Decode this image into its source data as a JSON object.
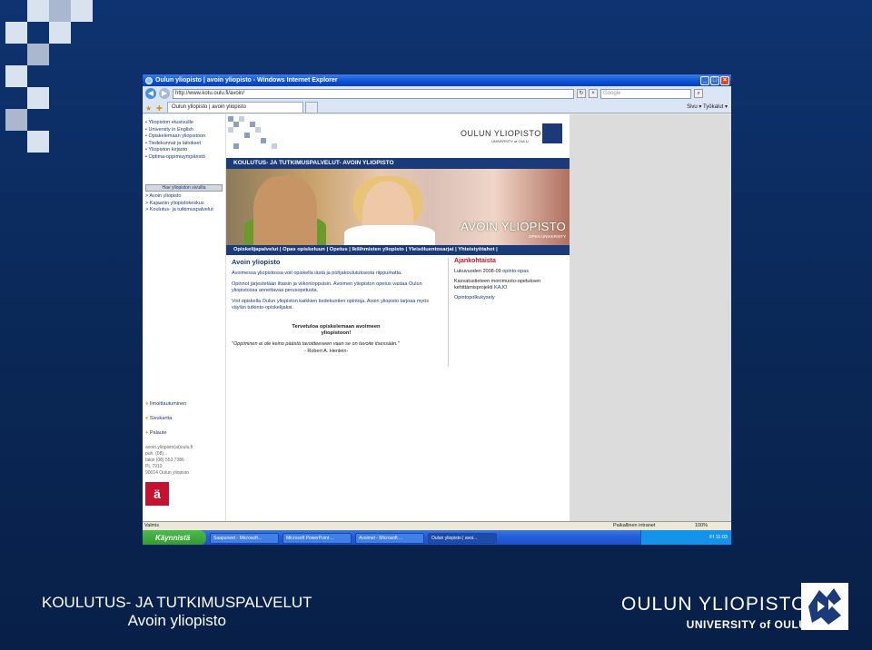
{
  "slide": {
    "title_line1": "KOULUTUS- JA TUTKIMUSPALVELUT",
    "title_line2": "Avoin yliopisto",
    "logo_line1": "OULUN YLIOPISTO",
    "logo_line2": "UNIVERSITY of OULU"
  },
  "window": {
    "title": "Oulun yliopisto | avoin yliopisto - Windows Internet Explorer",
    "url": "http://www.kotu.oulu.fi/avoin/",
    "search_placeholder": "Google",
    "tab_label": "Oulun yliopisto | avoin yliopisto",
    "toolbar_right": "Sivu ▾   Työkalut ▾"
  },
  "sidebar": {
    "items": [
      "Yliopiston etusivuille",
      "University in English",
      "Opiskelemaan yliopistoon",
      "Tiedekunnat ja laitokset",
      "Yliopiston kirjasto",
      "Optima-oppimisympäristö"
    ],
    "search_button": "Hae yliopiston sivuilta",
    "breadcrumbs": [
      "> Avoin yliopisto",
      "> Kajaanin yliopistokeskus",
      "> Koulutus- ja tutkimuspalvelut"
    ],
    "bottom_links": [
      "Ilmoittautuminen",
      "Sivukartta",
      "Palaute"
    ],
    "contact_email": "avoin.yliopisto(at)oulu.fi",
    "contact_phone": "puh. (08)...",
    "contact_fax": "faksi (08) 553 7386",
    "contact_box": "PL 7910",
    "contact_address": "90014 Oulun yliopisto"
  },
  "content": {
    "header_uni": "OULUN YLIOPISTO",
    "header_uni_sub": "UNIVERSITY of OULU",
    "bar_title": "KOULUTUS- JA TUTKIMUSPALVELUT- AVOIN YLIOPISTO",
    "hero_title": "AVOIN YLIOPISTO",
    "hero_sub": "OPEN UNIVERSITY",
    "menu": "Opiskelijapalvelut | Opas opiskeluun | Opetus | Ikilihmisten yliopisto | Yleisöluentosarjat | Yhteistyötahot |",
    "main_heading": "Avoin yliopisto",
    "paragraphs": [
      "Avoimessa yliopistossa voit opiskella iästä ja pohjakoulutuksesta riippumatta.",
      "Opinnot järjestetään iltaisin ja viikonloppuisin. Avoimen yliopiston opetus vastaa Oulun yliopistossa annettavaa perusopetusta.",
      "Voit opiskella Oulun yliopiston kaikkien tiedekuntien opintoja. Avoin yliopisto tarjoaa myös väylän tutkinto-opiskelijaksi."
    ],
    "welcome_line1": "Tervetuloa opiskelemaan avoimeen",
    "welcome_line2": "yliopistoon!",
    "quote": "\"Oppiminen ei ole keino päästä tavoitteeseen vaan se on tavoite itsessään.\"",
    "author": "- Robert A. Henlein-",
    "news_heading": "Ajankohtaista",
    "news": [
      {
        "text": "Lukuvuoden 2008-09 ",
        "link": "opinto-opas"
      },
      {
        "text": "Kasvatustieteen monimuoto-opetuksen kehittämisprojekti ",
        "link": "KAJO"
      },
      {
        "text": "",
        "link": "Opintopolkukysely"
      }
    ]
  },
  "status": {
    "left": "Valmis",
    "zone": "Paikallinen intranet",
    "zoom": "100%"
  },
  "taskbar": {
    "start": "Käynnistä",
    "items": [
      "Saapuneet - Microsoft...",
      "Microsoft PowerPoint ...",
      "Avoimet - Microsoft ...",
      "Oulun yliopisto | avoi..."
    ],
    "tray": "FI  11:03"
  }
}
